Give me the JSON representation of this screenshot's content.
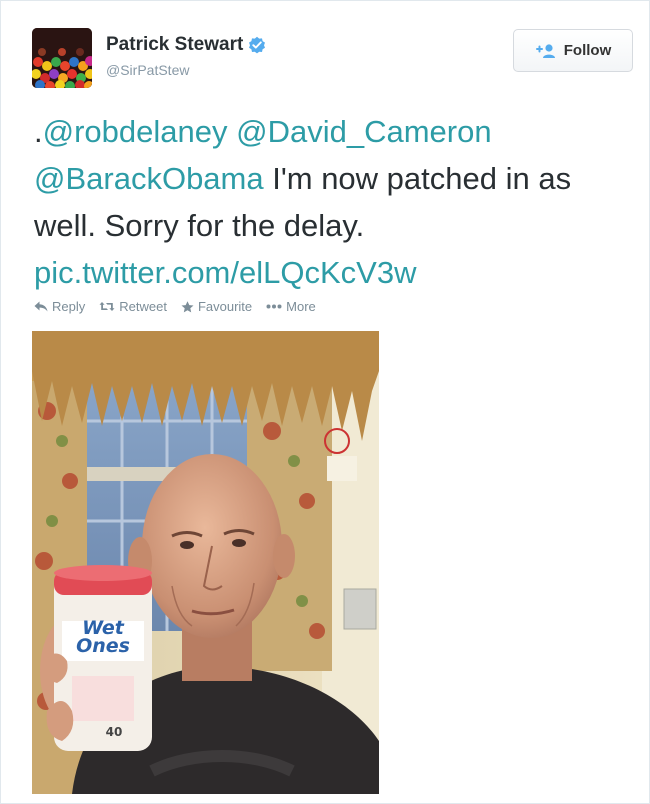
{
  "user": {
    "name": "Patrick Stewart",
    "handle": "@SirPatStew",
    "verified": true,
    "avatar_icon": "avatar-image"
  },
  "follow_button": {
    "label": "Follow",
    "icon": "add-user-icon"
  },
  "tweet": {
    "prefix": ".",
    "mention_1": "@robdelaney",
    "mention_2": "@David_Cameron",
    "mention_3": "@BarackObama",
    "body": " I'm now patched in as well. Sorry for the delay. ",
    "link": "pic.twitter.com/elLQcKcV3w"
  },
  "actions": {
    "reply": "Reply",
    "retweet": "Retweet",
    "favourite": "Favourite",
    "more": "More"
  },
  "photo": {
    "bottle_brand": "Wet Ones",
    "bottle_count": "40"
  },
  "colors": {
    "link": "#2d9ca6",
    "verified": "#55acee",
    "muted": "#8899a6"
  }
}
